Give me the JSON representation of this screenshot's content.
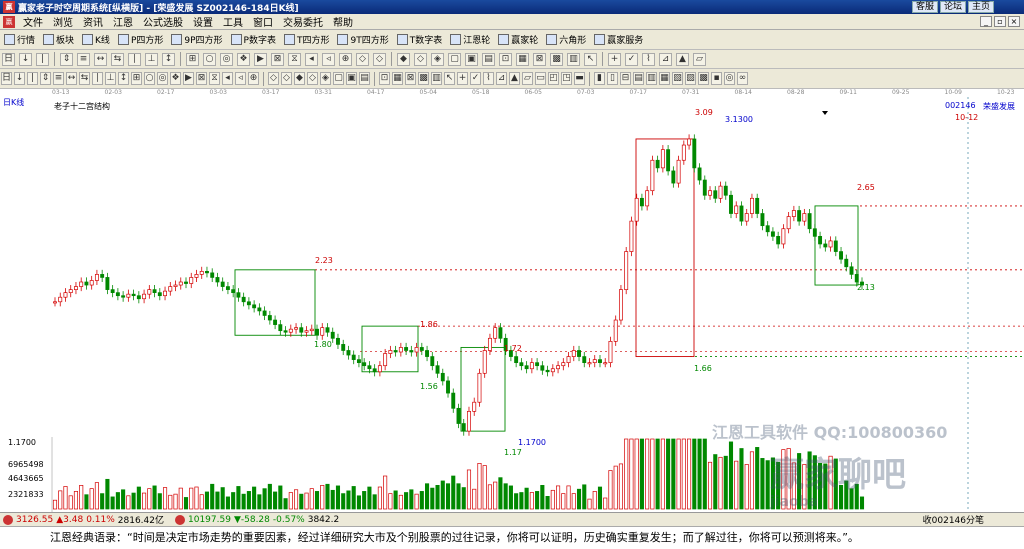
{
  "window": {
    "title": "赢家老子时空周期系统[纵横版] - [荣盛发展  SZ002146-184日K线]",
    "links": [
      "客服",
      "论坛",
      "主页"
    ]
  },
  "menu": [
    "文件",
    "浏览",
    "资讯",
    "江恩",
    "公式选股",
    "设置",
    "工具",
    "窗口",
    "交易委托",
    "帮助"
  ],
  "toolbar1": [
    {
      "icon": "ticker-icon",
      "label": "行情"
    },
    {
      "icon": "sector-icon",
      "label": "板块"
    },
    {
      "icon": "kline-icon",
      "label": "K线"
    },
    {
      "icon": "p-square-icon",
      "label": "P四方形"
    },
    {
      "icon": "9p-square-icon",
      "label": "9P四方形"
    },
    {
      "icon": "p-number-icon",
      "label": "P数字表"
    },
    {
      "icon": "t-square-icon",
      "label": "T四方形"
    },
    {
      "icon": "9t-square-icon",
      "label": "9T四方形"
    },
    {
      "icon": "t-number-icon",
      "label": "T数字表"
    },
    {
      "icon": "gann-wheel-icon",
      "label": "江恩轮"
    },
    {
      "icon": "winner-wheel-icon",
      "label": "赢家轮"
    },
    {
      "icon": "hexagon-icon",
      "label": "六角形"
    },
    {
      "icon": "service-icon",
      "label": "赢家服务"
    }
  ],
  "chart_header": {
    "period": "日K线",
    "indicator": "老子十二宫结构",
    "code": "002146",
    "name": "荣盛发展",
    "date_marker": "10-12"
  },
  "date_axis": [
    "03-13",
    "02-03",
    "02-17",
    "03-03",
    "03-17",
    "03-31",
    "04-17",
    "05-04",
    "05-18",
    "06-05",
    "07-03",
    "07-17",
    "07-31",
    "08-14",
    "08-28",
    "09-11",
    "09-25",
    "10-09",
    "10-23"
  ],
  "chart_data": {
    "type": "candlestick",
    "price_labels": [
      "2.23",
      "1.80",
      "1.86",
      "1.56",
      "1.72",
      "1.17",
      "1.66",
      "3.09",
      "3.1300",
      "2.65",
      "2.13",
      "1.1700"
    ],
    "axis_labels": [
      "1.1700",
      "6965498",
      "4643665",
      "2321833"
    ],
    "resistance_lines": [
      2.23,
      1.86,
      2.65
    ],
    "support_lines": [
      1.66
    ],
    "boxes": [
      {
        "from": "03-17",
        "to": "03-31",
        "high": 2.23,
        "low": 1.8
      },
      {
        "from": "04-17",
        "to": "05-04",
        "high": 1.86,
        "low": 1.56
      },
      {
        "from": "05-18",
        "to": "06-05",
        "high": 1.72,
        "low": 1.17
      },
      {
        "from": "07-17",
        "to": "07-31",
        "high": 3.09,
        "low": 1.66
      },
      {
        "from": "08-28",
        "to": "09-11",
        "high": 2.65,
        "low": 2.13
      }
    ]
  },
  "watermark": {
    "brand": "江恩工具软件  QQ:100800360",
    "forum": "赢家聊吧",
    "site": "jiaoba"
  },
  "status": {
    "sh_index": "3126.55",
    "sh_change": "▲3.48",
    "sh_pct": "0.11%",
    "sh_amount": "2816.42亿",
    "sz_index": "10197.59",
    "sz_change": "▼-58.28",
    "sz_pct": "-0.57%",
    "sz_amount": "3842.2",
    "right": "收002146分笔"
  },
  "quote": "江恩经典语录：“时间是决定市场走势的重要因素，经过详细研究大市及个别股票的过往记录，你将可以证明，历史确实重复发生；而了解过往，你将可以预测将来。”。",
  "colors": {
    "up": "#d40000",
    "down": "#008800",
    "title_bg": "#0a2a78",
    "resist": "#cc0000",
    "support": "#008800"
  }
}
